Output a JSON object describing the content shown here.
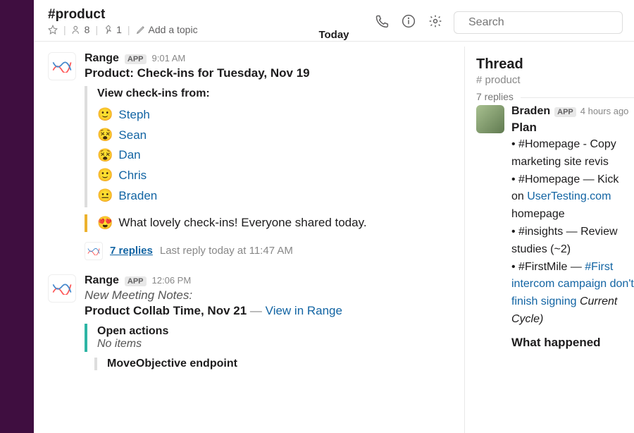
{
  "channel": {
    "name": "#product",
    "member_count": "8",
    "pin_count": "1",
    "topic_placeholder": "Add a topic"
  },
  "search": {
    "placeholder": "Search"
  },
  "date_divider": "Today",
  "messages": [
    {
      "author": "Range",
      "badge": "APP",
      "time": "9:01 AM",
      "title": "Product: Check-ins for Tuesday, Nov 19",
      "checkins_heading": "View check-ins from:",
      "checkins": [
        {
          "emoji": "🙂",
          "name": "Steph"
        },
        {
          "emoji": "😵",
          "name": "Sean"
        },
        {
          "emoji": "😵",
          "name": "Dan"
        },
        {
          "emoji": "🙂",
          "name": "Chris"
        },
        {
          "emoji": "😐",
          "name": "Braden"
        }
      ],
      "lovely_text": "What lovely check-ins! Everyone shared today.",
      "replies_link": "7 replies",
      "last_reply": "Last reply today at 11:47 AM"
    },
    {
      "author": "Range",
      "badge": "APP",
      "time": "12:06 PM",
      "subtitle": "New Meeting Notes:",
      "meeting_title": "Product Collab Time, Nov 21",
      "view_link": "View in Range",
      "open_actions_label": "Open actions",
      "no_items": "No items",
      "move_objective": "MoveObjective endpoint"
    }
  ],
  "thread": {
    "title": "Thread",
    "channel": "# product",
    "reply_count": "7 replies",
    "author": "Braden",
    "badge": "APP",
    "time": "4 hours ago",
    "plan_label": "Plan",
    "bullets_html": "• #Homepage - Copy marketing site revis<br>• #Homepage — Kick on <a>UserTesting.com</a> homepage<br>• #insights — Review studies (~2)<br>• #FirstMile — <a>#First intercom campaign don't finish signing</a> <em>Current Cycle)</em>",
    "what_happened": "What happened"
  }
}
